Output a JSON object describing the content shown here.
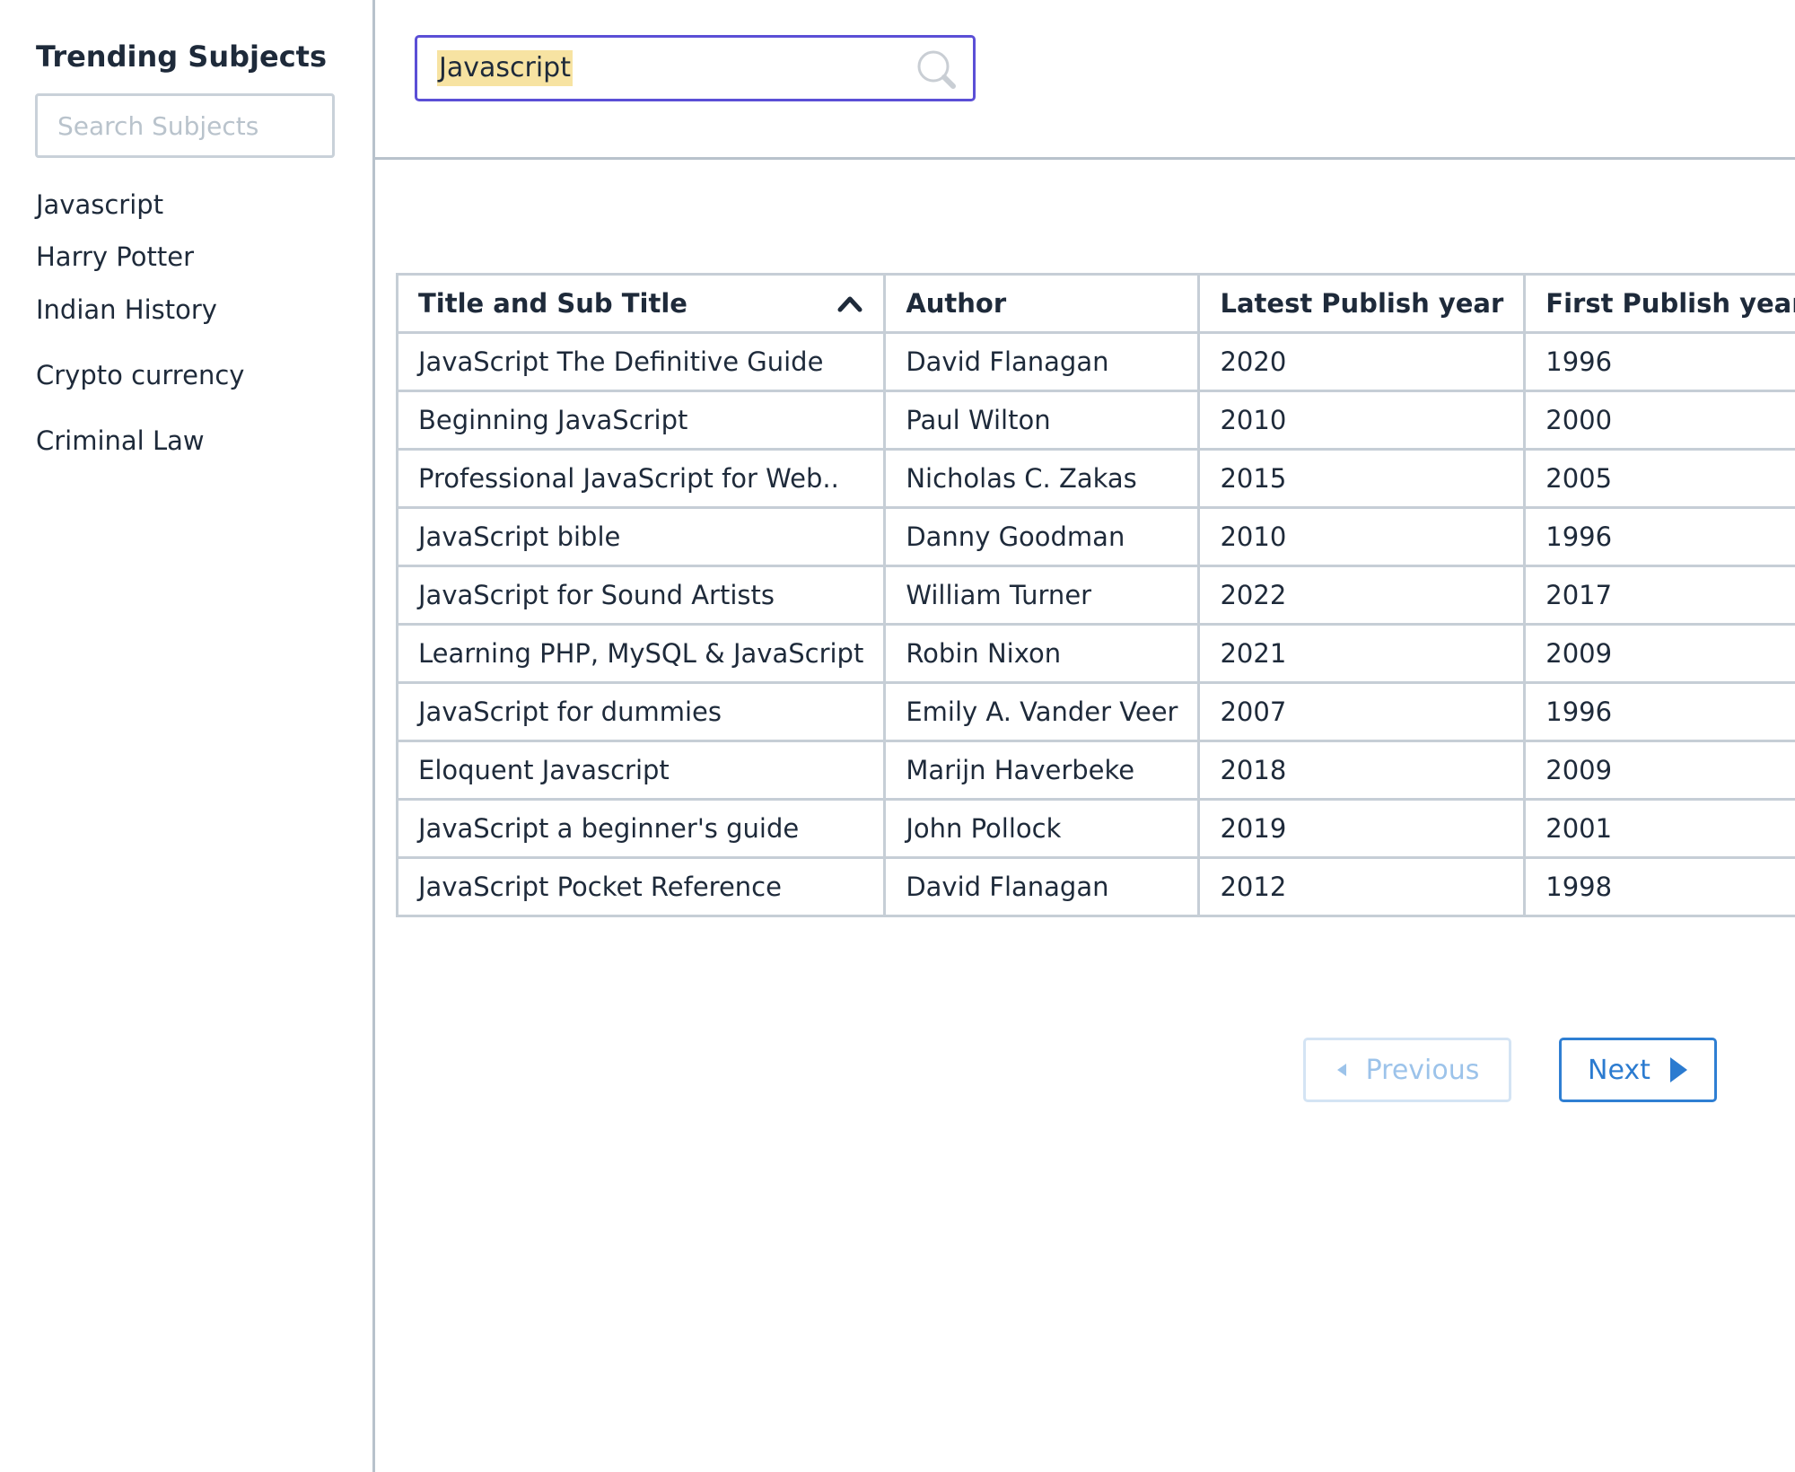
{
  "sidebar": {
    "title": "Trending Subjects",
    "search_placeholder": "Search Subjects",
    "subjects": [
      "Javascript",
      "Harry Potter",
      "Indian History",
      "Crypto currency",
      "Criminal Law"
    ]
  },
  "search": {
    "value": "Javascript",
    "icon": "search-icon"
  },
  "table": {
    "columns": [
      "Title and Sub Title",
      "Author",
      "Latest Publish year",
      "First Publish year"
    ],
    "sort": {
      "column": "Title and Sub Title",
      "icon": "chevron-up-icon"
    },
    "rows": [
      {
        "title": "JavaScript The Definitive Guide",
        "author": "David Flanagan",
        "latest": "2020",
        "first": "1996"
      },
      {
        "title": "Beginning JavaScript",
        "author": "Paul Wilton",
        "latest": "2010",
        "first": "2000"
      },
      {
        "title": "Professional JavaScript for Web..",
        "author": "Nicholas C. Zakas",
        "latest": "2015",
        "first": "2005"
      },
      {
        "title": "JavaScript bible",
        "author": "Danny Goodman",
        "latest": "2010",
        "first": "1996"
      },
      {
        "title": "JavaScript for Sound Artists",
        "author": "William Turner",
        "latest": "2022",
        "first": "2017"
      },
      {
        "title": "Learning PHP, MySQL & JavaScript",
        "author": "Robin Nixon",
        "latest": "2021",
        "first": "2009"
      },
      {
        "title": "JavaScript for dummies",
        "author": "Emily A. Vander Veer",
        "latest": "2007",
        "first": "1996"
      },
      {
        "title": "Eloquent Javascript",
        "author": "Marijn Haverbeke",
        "latest": "2018",
        "first": "2009"
      },
      {
        "title": "JavaScript a beginner's guide",
        "author": "John Pollock",
        "latest": "2019",
        "first": "2001"
      },
      {
        "title": "JavaScript Pocket Reference",
        "author": "David Flanagan",
        "latest": "2012",
        "first": "1998"
      }
    ]
  },
  "pagination": {
    "previous_label": "Previous",
    "next_label": "Next",
    "previous_disabled": true
  },
  "colors": {
    "accent": "#5b4fd6",
    "link_blue": "#2b7bd0",
    "disabled_blue": "#9cc3ea",
    "highlight": "#f7e3a2",
    "border": "#c6ced6",
    "text": "#1e2a3a"
  }
}
